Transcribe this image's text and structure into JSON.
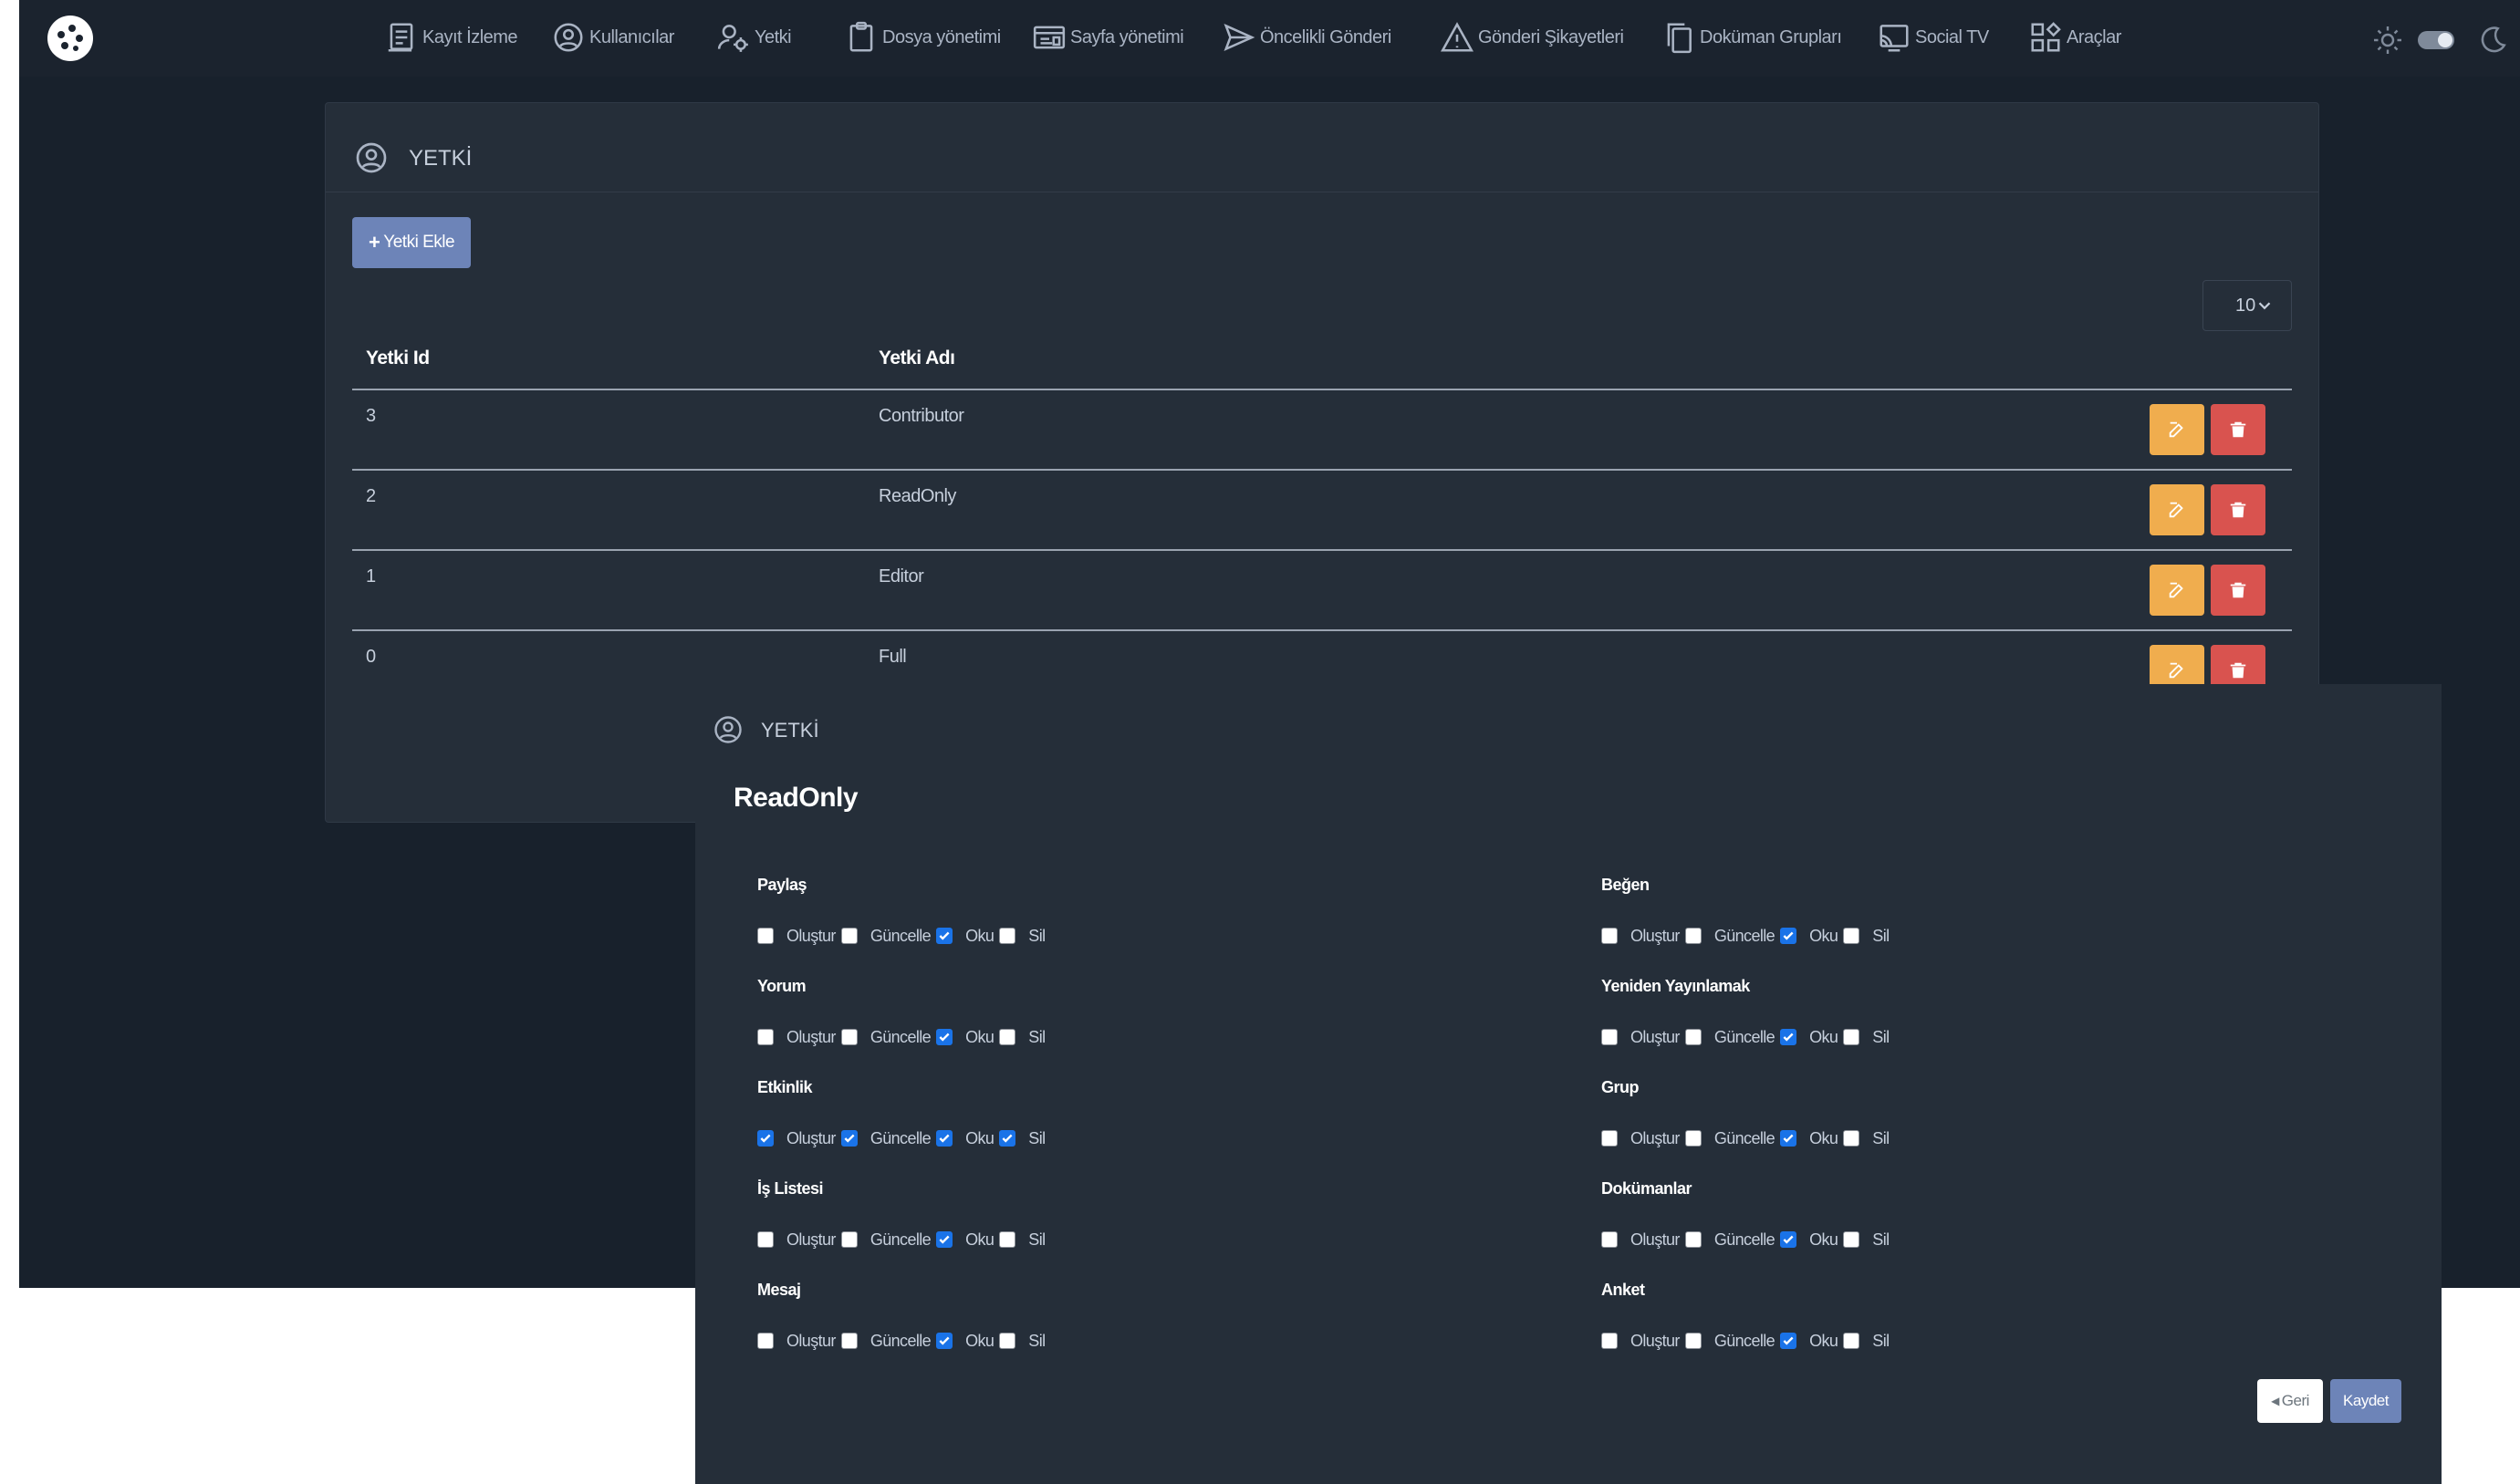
{
  "nav": {
    "items": [
      {
        "label": "Kayıt İzleme",
        "icon": "document-list-icon"
      },
      {
        "label": "Kullanıcılar",
        "icon": "user-circle-icon"
      },
      {
        "label": "Yetki",
        "icon": "user-gear-icon"
      },
      {
        "label": "Dosya yönetimi",
        "icon": "clipboard-icon"
      },
      {
        "label": "Sayfa yönetimi",
        "icon": "browser-window-icon"
      },
      {
        "label": "Öncelikli Gönderi",
        "icon": "send-icon"
      },
      {
        "label": "Gönderi Şikayetleri",
        "icon": "warning-icon"
      },
      {
        "label": "Doküman Grupları",
        "icon": "copy-icon"
      },
      {
        "label": "Social TV",
        "icon": "cast-icon"
      },
      {
        "label": "Araçlar",
        "icon": "apps-icon"
      }
    ]
  },
  "page": {
    "title": "YETKİ",
    "add_button": "Yetki Ekle",
    "page_size": "10",
    "columns": {
      "id": "Yetki Id",
      "name": "Yetki Adı"
    },
    "rows": [
      {
        "id": "3",
        "name": "Contributor"
      },
      {
        "id": "2",
        "name": "ReadOnly"
      },
      {
        "id": "1",
        "name": "Editor"
      },
      {
        "id": "0",
        "name": "Full"
      }
    ]
  },
  "modal": {
    "title": "YETKİ",
    "role_name": "ReadOnly",
    "option_labels": {
      "create": "Oluştur",
      "update": "Güncelle",
      "read": "Oku",
      "delete": "Sil"
    },
    "left": [
      {
        "label": "Paylaş",
        "create": false,
        "update": false,
        "read": true,
        "delete": false
      },
      {
        "label": "Yorum",
        "create": false,
        "update": false,
        "read": true,
        "delete": false
      },
      {
        "label": "Etkinlik",
        "create": true,
        "update": true,
        "read": true,
        "delete": true
      },
      {
        "label": "İş Listesi",
        "create": false,
        "update": false,
        "read": true,
        "delete": false
      },
      {
        "label": "Mesaj",
        "create": false,
        "update": false,
        "read": true,
        "delete": false
      }
    ],
    "right": [
      {
        "label": "Beğen",
        "create": false,
        "update": false,
        "read": true,
        "delete": false
      },
      {
        "label": "Yeniden Yayınlamak",
        "create": false,
        "update": false,
        "read": true,
        "delete": false
      },
      {
        "label": "Grup",
        "create": false,
        "update": false,
        "read": true,
        "delete": false
      },
      {
        "label": "Dokümanlar",
        "create": false,
        "update": false,
        "read": true,
        "delete": false
      },
      {
        "label": "Anket",
        "create": false,
        "update": false,
        "read": true,
        "delete": false
      }
    ],
    "back_button": "Geri",
    "save_button": "Kaydet"
  },
  "colors": {
    "background": "#18212c",
    "panel": "#252e39",
    "primary": "#6d84b8",
    "edit": "#f0ad4e",
    "delete": "#d9534f",
    "checkbox_checked": "#1a73e8"
  }
}
